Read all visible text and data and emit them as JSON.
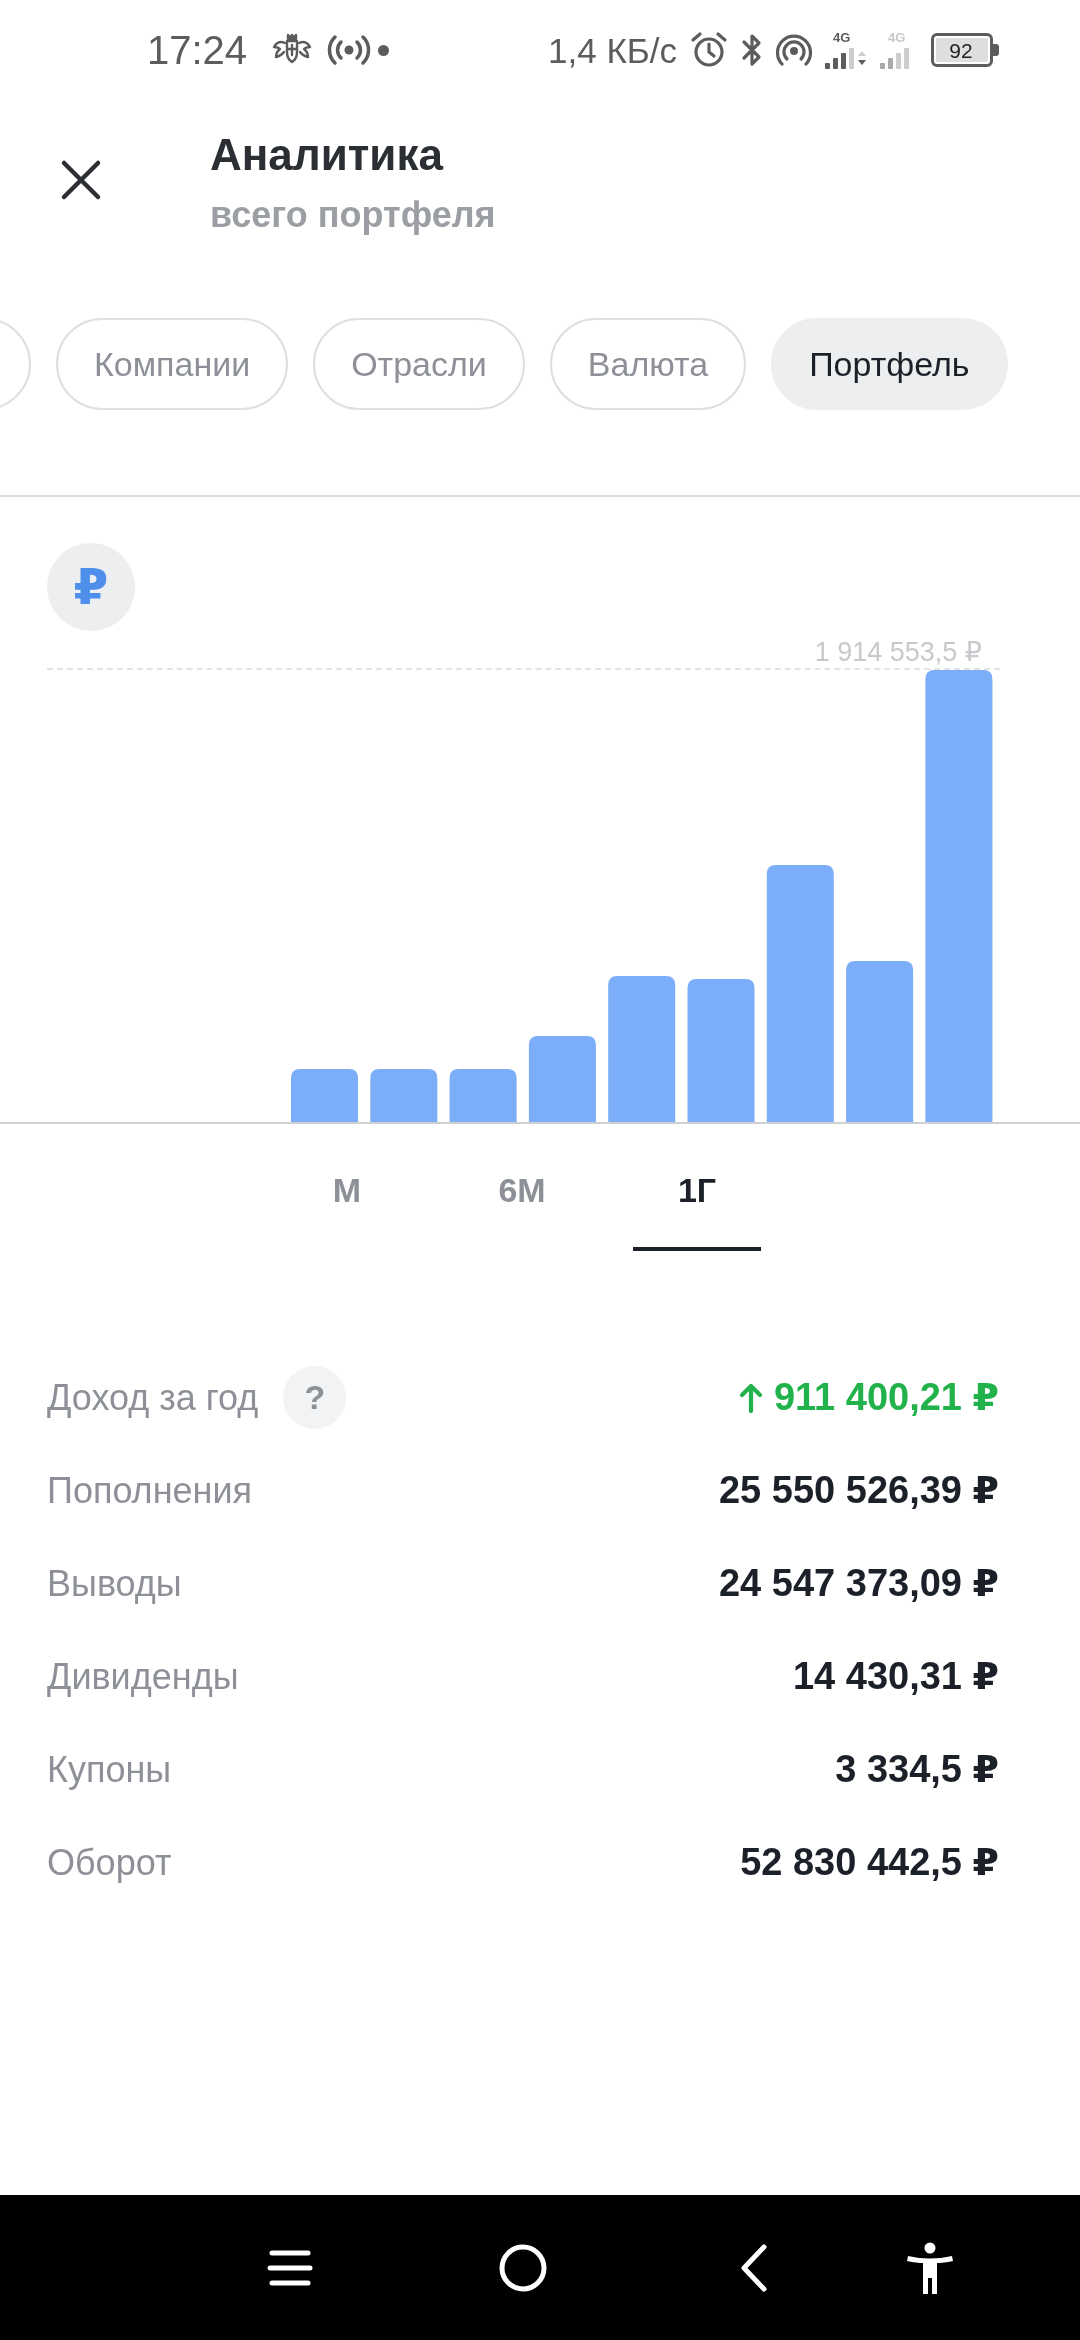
{
  "status_bar": {
    "time": "17:24",
    "speed": "1,4 КБ/с",
    "sims": [
      {
        "network": "4G",
        "active": true
      },
      {
        "network": "4G",
        "active": false
      }
    ],
    "battery": "92"
  },
  "header": {
    "title": "Аналитика",
    "subtitle": "всего портфеля"
  },
  "filters": {
    "scrolled": true,
    "items": [
      {
        "label": "Компании",
        "selected": false
      },
      {
        "label": "Отрасли",
        "selected": false
      },
      {
        "label": "Валюта",
        "selected": false
      },
      {
        "label": "Портфель",
        "selected": true
      }
    ]
  },
  "chart": {
    "currency": "₽",
    "max_label": "1 914 553,5 ₽"
  },
  "periods": [
    {
      "label": "М",
      "selected": false
    },
    {
      "label": "6М",
      "selected": false
    },
    {
      "label": "1Г",
      "selected": true
    }
  ],
  "stats": [
    {
      "label": "Доход за год",
      "hint": "?",
      "value": "911 400,21 ₽",
      "kind": "gain"
    },
    {
      "label": "Пополнения",
      "value": "25 550 526,39 ₽",
      "kind": "plain"
    },
    {
      "label": "Выводы",
      "value": "24 547 373,09 ₽",
      "kind": "plain"
    },
    {
      "label": "Дивиденды",
      "value": "14 430,31 ₽",
      "kind": "plain"
    },
    {
      "label": "Купоны",
      "value": "3 334,5 ₽",
      "kind": "plain"
    },
    {
      "label": "Оборот",
      "value": "52 830 442,5 ₽",
      "kind": "plain"
    }
  ]
}
